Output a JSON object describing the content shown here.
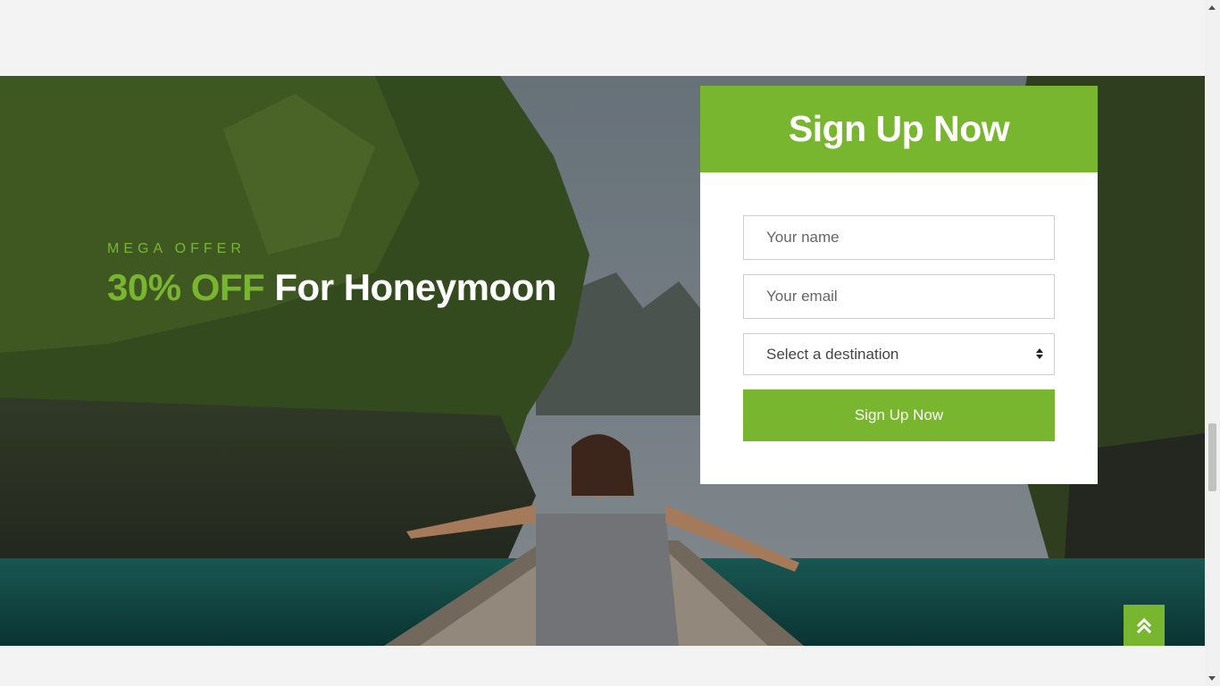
{
  "offer": {
    "kicker": "MEGA OFFER",
    "discount": "30% OFF",
    "headline_rest": "For Honeymoon"
  },
  "signup": {
    "title": "Sign Up Now",
    "name_placeholder": "Your name",
    "email_placeholder": "Your email",
    "destination_selected": "Select a destination",
    "submit_label": "Sign Up Now"
  },
  "colors": {
    "accent": "#78b62f",
    "page_background": "#f3f3f3",
    "card_background": "#ffffff"
  },
  "icons": {
    "back_to_top": "double-chevron-up-icon"
  }
}
